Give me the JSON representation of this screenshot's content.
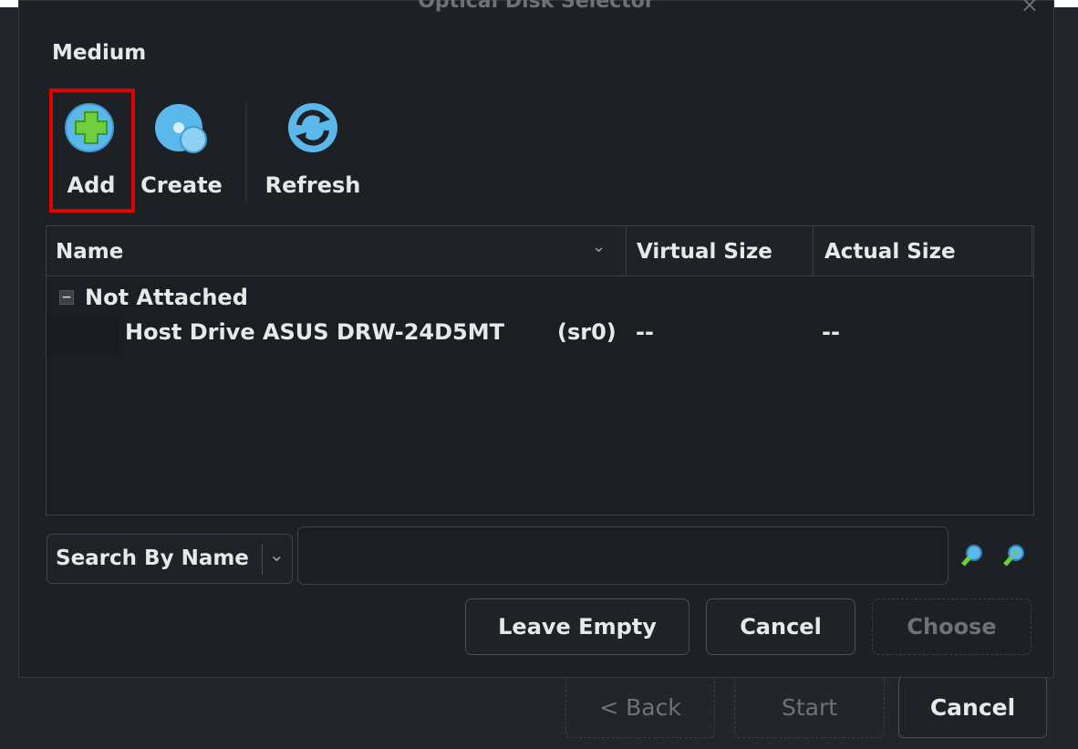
{
  "dialog": {
    "title": "Optical Disk Selector",
    "close_glyph": "×",
    "medium_label": "Medium"
  },
  "toolbar": {
    "add_label": "Add",
    "create_label": "Create",
    "refresh_label": "Refresh"
  },
  "tree": {
    "columns": [
      "Name",
      "Virtual Size",
      "Actual Size"
    ],
    "group": {
      "label": "Not Attached",
      "collapse_glyph": "−"
    },
    "items": [
      {
        "name": "Host Drive ASUS DRW-24D5MT",
        "device": "(sr0)",
        "virtual_size": "--",
        "actual_size": "--"
      }
    ]
  },
  "search": {
    "mode": "Search By Name",
    "value": ""
  },
  "buttons": {
    "leave_empty": "Leave Empty",
    "cancel": "Cancel",
    "choose": "Choose"
  },
  "wizard": {
    "back": "< Back",
    "start": "Start",
    "cancel": "Cancel"
  },
  "colors": {
    "highlight": "#e00000",
    "accent_green": "#6fce3e",
    "icon_blue": "#5bb8ea"
  }
}
